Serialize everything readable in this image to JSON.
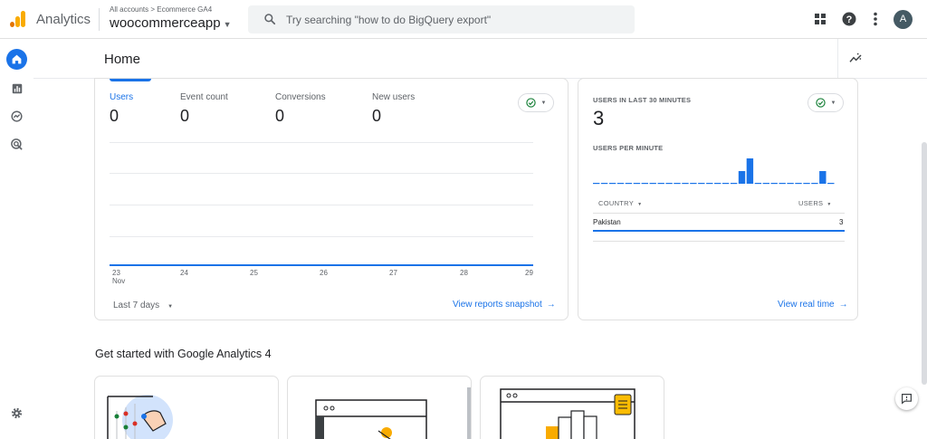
{
  "app": {
    "name": "Analytics",
    "crumb": "All accounts > Ecommerce GA4",
    "account": "woocommerceapp"
  },
  "search": {
    "placeholder": "Try searching \"how to do BigQuery export\""
  },
  "user": {
    "initial": "A"
  },
  "icons": [
    "analytics-logo-icon",
    "search-icon",
    "apps-grid-icon",
    "help-icon",
    "more-vert-icon",
    "home-icon",
    "reports-icon",
    "explore-icon",
    "advertising-icon",
    "settings-icon",
    "insights-icon",
    "check-circle-icon",
    "caret-down-icon",
    "arrow-right-icon",
    "feedback-icon"
  ],
  "colors": {
    "accent": "#1a73e8",
    "logo_orange": "#f9ab00",
    "logo_dark": "#e37400",
    "success": "#188038"
  },
  "page": {
    "title": "Home"
  },
  "overview": {
    "metrics": [
      {
        "label": "Users",
        "value": "0"
      },
      {
        "label": "Event count",
        "value": "0"
      },
      {
        "label": "Conversions",
        "value": "0"
      },
      {
        "label": "New users",
        "value": "0"
      }
    ],
    "x_labels": [
      "23",
      "24",
      "25",
      "26",
      "27",
      "28",
      "29"
    ],
    "x_month": "Nov",
    "range": "Last 7 days",
    "link": "View reports snapshot"
  },
  "chart_data": {
    "type": "line",
    "x": [
      "23 Nov",
      "24",
      "25",
      "26",
      "27",
      "28",
      "29"
    ],
    "series": [
      {
        "values": [
          0,
          0,
          0,
          0,
          0,
          0,
          0
        ]
      }
    ]
  },
  "realtime": {
    "title": "USERS IN LAST 30 MINUTES",
    "value": "3",
    "per_minute_label": "USERS PER MINUTE",
    "per_minute": [
      0,
      0,
      0,
      0,
      0,
      0,
      0,
      0,
      0,
      0,
      0,
      0,
      0,
      0,
      0,
      0,
      0,
      0,
      1,
      2,
      0,
      0,
      0,
      0,
      0,
      0,
      0,
      0,
      1,
      0
    ],
    "col_country": "COUNTRY",
    "col_users": "USERS",
    "rows": [
      {
        "country": "Pakistan",
        "users": "3"
      }
    ],
    "link": "View real time"
  },
  "getting_started": {
    "title": "Get started with Google Analytics 4"
  }
}
